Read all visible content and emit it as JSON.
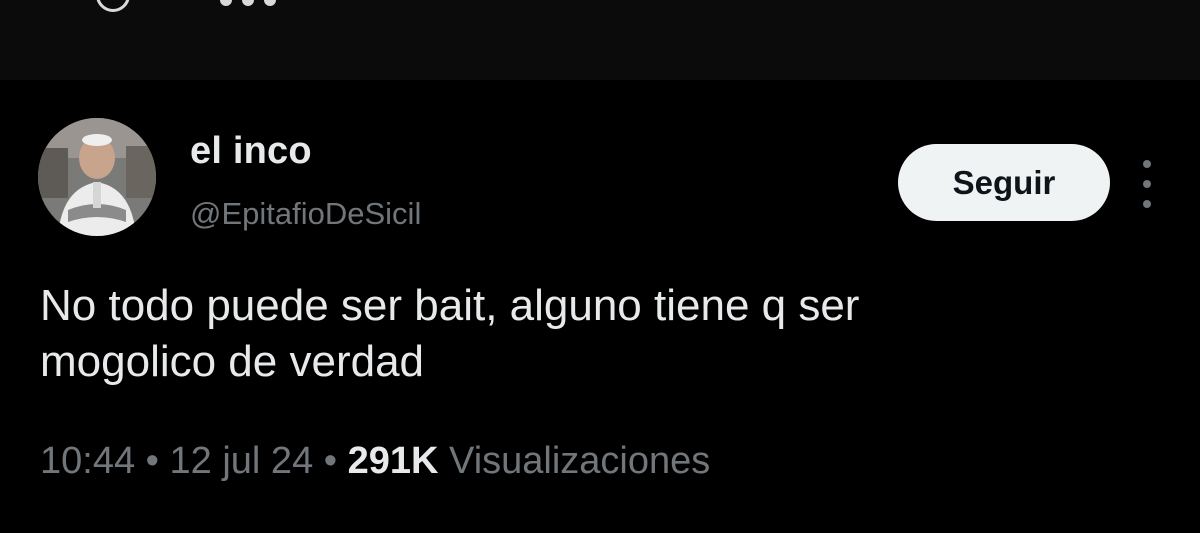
{
  "tweet": {
    "author": {
      "display_name": "el inco",
      "handle": "@EpitafioDeSicil"
    },
    "follow_label": "Seguir",
    "text": "No todo puede ser bait, alguno tiene q ser\nmogolico de verdad",
    "time": "10:44",
    "separator": "•",
    "date": "12 jul 24",
    "views_count": "291K",
    "views_label": "Visualizaciones"
  },
  "icons": {
    "avatar": "avatar-photo",
    "more": "more-options-icon"
  },
  "colors": {
    "background": "#000000",
    "primary_text": "#e7e9ea",
    "secondary_text": "#71767b",
    "follow_button_bg": "#eff3f4",
    "follow_button_text": "#0f1419"
  }
}
